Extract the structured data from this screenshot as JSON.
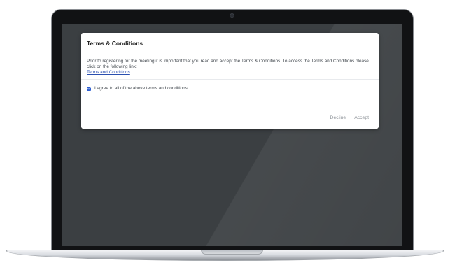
{
  "dialog": {
    "title": "Terms & Conditions",
    "body_text": "Prior to registering for the meeting it is important that you read and accept the Terms & Conditions. To access the Terms and Conditions please click on the following link:",
    "terms_link_label": "Terms and Conditions",
    "agree_checkbox": {
      "label": "I agree to all of the above terms and conditions",
      "checked": true
    },
    "decline_label": "Decline",
    "accept_label": "Accept"
  },
  "colors": {
    "link": "#2a4fb0",
    "checkbox": "#2f5fd0",
    "button_text": "#8e9399",
    "screen_background": "#3b3f42"
  }
}
